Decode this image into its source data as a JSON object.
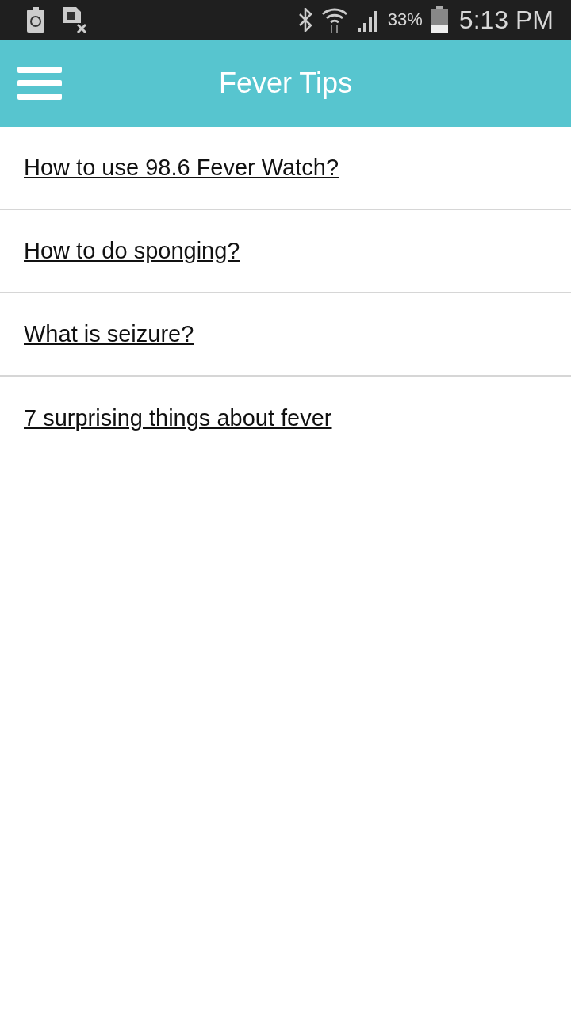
{
  "status_bar": {
    "battery_percent": "33%",
    "time": "5:13 PM"
  },
  "app_bar": {
    "title": "Fever Tips"
  },
  "tips": [
    {
      "label": "How to use 98.6 Fever Watch?"
    },
    {
      "label": "How to do sponging?"
    },
    {
      "label": "What is seizure?"
    },
    {
      "label": "7 surprising things about fever"
    }
  ]
}
